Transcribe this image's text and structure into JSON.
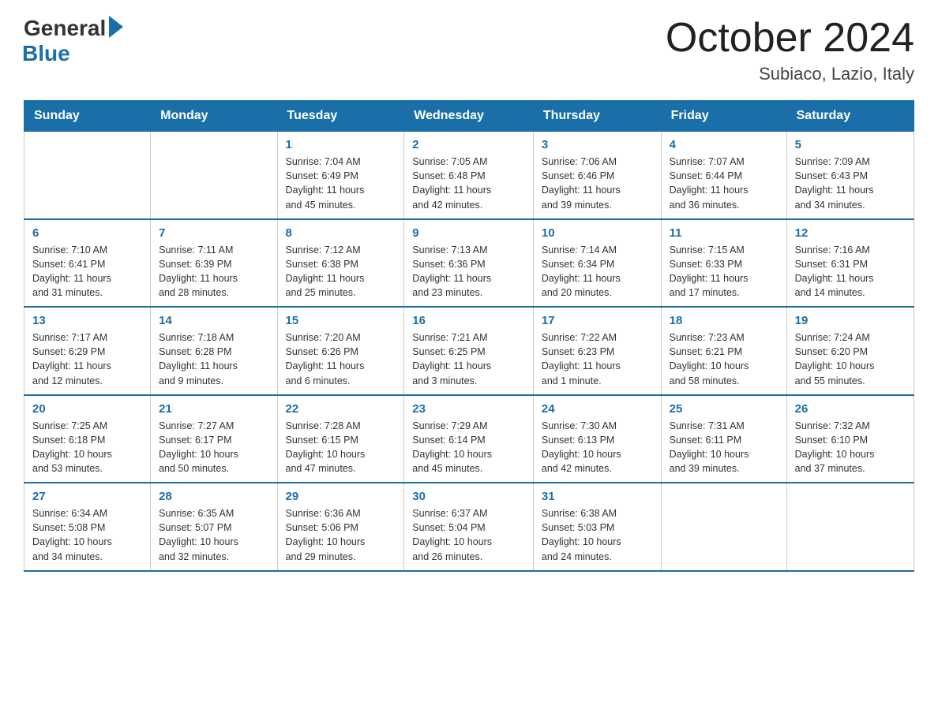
{
  "header": {
    "logo_general": "General",
    "logo_blue": "Blue",
    "month_year": "October 2024",
    "location": "Subiaco, Lazio, Italy"
  },
  "days_of_week": [
    "Sunday",
    "Monday",
    "Tuesday",
    "Wednesday",
    "Thursday",
    "Friday",
    "Saturday"
  ],
  "weeks": [
    [
      {
        "day": "",
        "info": ""
      },
      {
        "day": "",
        "info": ""
      },
      {
        "day": "1",
        "info": "Sunrise: 7:04 AM\nSunset: 6:49 PM\nDaylight: 11 hours\nand 45 minutes."
      },
      {
        "day": "2",
        "info": "Sunrise: 7:05 AM\nSunset: 6:48 PM\nDaylight: 11 hours\nand 42 minutes."
      },
      {
        "day": "3",
        "info": "Sunrise: 7:06 AM\nSunset: 6:46 PM\nDaylight: 11 hours\nand 39 minutes."
      },
      {
        "day": "4",
        "info": "Sunrise: 7:07 AM\nSunset: 6:44 PM\nDaylight: 11 hours\nand 36 minutes."
      },
      {
        "day": "5",
        "info": "Sunrise: 7:09 AM\nSunset: 6:43 PM\nDaylight: 11 hours\nand 34 minutes."
      }
    ],
    [
      {
        "day": "6",
        "info": "Sunrise: 7:10 AM\nSunset: 6:41 PM\nDaylight: 11 hours\nand 31 minutes."
      },
      {
        "day": "7",
        "info": "Sunrise: 7:11 AM\nSunset: 6:39 PM\nDaylight: 11 hours\nand 28 minutes."
      },
      {
        "day": "8",
        "info": "Sunrise: 7:12 AM\nSunset: 6:38 PM\nDaylight: 11 hours\nand 25 minutes."
      },
      {
        "day": "9",
        "info": "Sunrise: 7:13 AM\nSunset: 6:36 PM\nDaylight: 11 hours\nand 23 minutes."
      },
      {
        "day": "10",
        "info": "Sunrise: 7:14 AM\nSunset: 6:34 PM\nDaylight: 11 hours\nand 20 minutes."
      },
      {
        "day": "11",
        "info": "Sunrise: 7:15 AM\nSunset: 6:33 PM\nDaylight: 11 hours\nand 17 minutes."
      },
      {
        "day": "12",
        "info": "Sunrise: 7:16 AM\nSunset: 6:31 PM\nDaylight: 11 hours\nand 14 minutes."
      }
    ],
    [
      {
        "day": "13",
        "info": "Sunrise: 7:17 AM\nSunset: 6:29 PM\nDaylight: 11 hours\nand 12 minutes."
      },
      {
        "day": "14",
        "info": "Sunrise: 7:18 AM\nSunset: 6:28 PM\nDaylight: 11 hours\nand 9 minutes."
      },
      {
        "day": "15",
        "info": "Sunrise: 7:20 AM\nSunset: 6:26 PM\nDaylight: 11 hours\nand 6 minutes."
      },
      {
        "day": "16",
        "info": "Sunrise: 7:21 AM\nSunset: 6:25 PM\nDaylight: 11 hours\nand 3 minutes."
      },
      {
        "day": "17",
        "info": "Sunrise: 7:22 AM\nSunset: 6:23 PM\nDaylight: 11 hours\nand 1 minute."
      },
      {
        "day": "18",
        "info": "Sunrise: 7:23 AM\nSunset: 6:21 PM\nDaylight: 10 hours\nand 58 minutes."
      },
      {
        "day": "19",
        "info": "Sunrise: 7:24 AM\nSunset: 6:20 PM\nDaylight: 10 hours\nand 55 minutes."
      }
    ],
    [
      {
        "day": "20",
        "info": "Sunrise: 7:25 AM\nSunset: 6:18 PM\nDaylight: 10 hours\nand 53 minutes."
      },
      {
        "day": "21",
        "info": "Sunrise: 7:27 AM\nSunset: 6:17 PM\nDaylight: 10 hours\nand 50 minutes."
      },
      {
        "day": "22",
        "info": "Sunrise: 7:28 AM\nSunset: 6:15 PM\nDaylight: 10 hours\nand 47 minutes."
      },
      {
        "day": "23",
        "info": "Sunrise: 7:29 AM\nSunset: 6:14 PM\nDaylight: 10 hours\nand 45 minutes."
      },
      {
        "day": "24",
        "info": "Sunrise: 7:30 AM\nSunset: 6:13 PM\nDaylight: 10 hours\nand 42 minutes."
      },
      {
        "day": "25",
        "info": "Sunrise: 7:31 AM\nSunset: 6:11 PM\nDaylight: 10 hours\nand 39 minutes."
      },
      {
        "day": "26",
        "info": "Sunrise: 7:32 AM\nSunset: 6:10 PM\nDaylight: 10 hours\nand 37 minutes."
      }
    ],
    [
      {
        "day": "27",
        "info": "Sunrise: 6:34 AM\nSunset: 5:08 PM\nDaylight: 10 hours\nand 34 minutes."
      },
      {
        "day": "28",
        "info": "Sunrise: 6:35 AM\nSunset: 5:07 PM\nDaylight: 10 hours\nand 32 minutes."
      },
      {
        "day": "29",
        "info": "Sunrise: 6:36 AM\nSunset: 5:06 PM\nDaylight: 10 hours\nand 29 minutes."
      },
      {
        "day": "30",
        "info": "Sunrise: 6:37 AM\nSunset: 5:04 PM\nDaylight: 10 hours\nand 26 minutes."
      },
      {
        "day": "31",
        "info": "Sunrise: 6:38 AM\nSunset: 5:03 PM\nDaylight: 10 hours\nand 24 minutes."
      },
      {
        "day": "",
        "info": ""
      },
      {
        "day": "",
        "info": ""
      }
    ]
  ]
}
